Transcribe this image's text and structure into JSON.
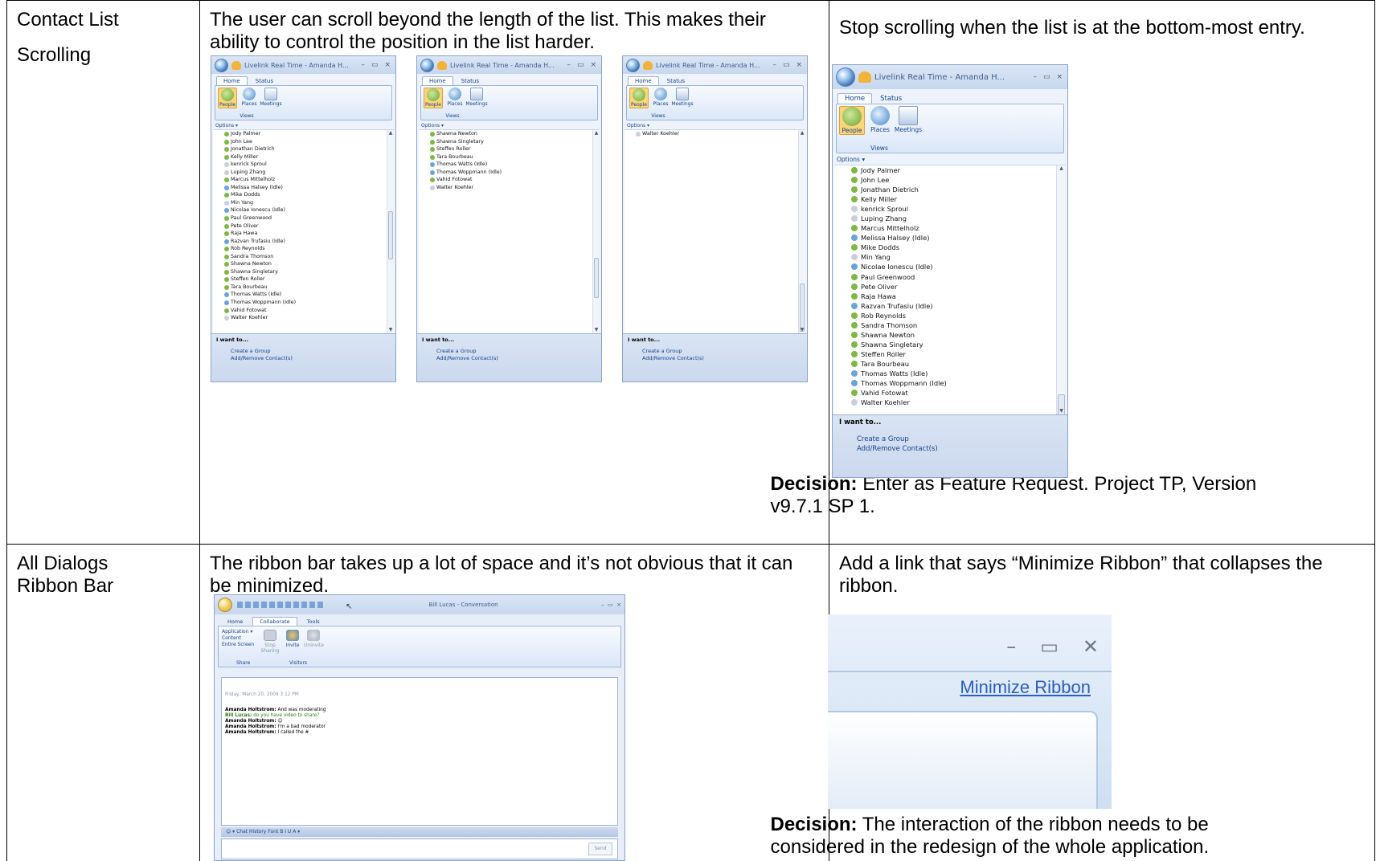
{
  "rows": [
    {
      "topic_lines": [
        "Contact List",
        "Scrolling"
      ],
      "issue": "The user can scroll beyond the length of the list. This makes their ability to control the position in the list harder.",
      "recommendation": "Stop scrolling when the list is at the bottom-most entry.",
      "decision_label": "Decision:",
      "decision": "Enter as Feature Request. Project TP, Version v9.7.1 SP 1."
    },
    {
      "topic_lines": [
        "All Dialogs",
        "Ribbon Bar"
      ],
      "issue": "The ribbon bar takes up a lot of space and it’s not obvious that it can be minimized.",
      "recommendation": "Add a link that says “Minimize Ribbon” that collapses the ribbon.",
      "decision_label": "Decision:",
      "decision": "The interaction of the ribbon needs to be considered in the redesign of the whole application."
    }
  ],
  "livelink": {
    "title": "Livelink Real Time - Amanda H...",
    "tabs": [
      "Home",
      "Status"
    ],
    "ribbon_buttons": [
      "People",
      "Places",
      "Meetings"
    ],
    "views_label": "Views",
    "options_label": "Options ▾",
    "window_controls": [
      "–",
      "▭",
      "×"
    ],
    "i_want_to": "I want to...",
    "actions": [
      "Create a Group",
      "Add/Remove Contact(s)"
    ],
    "contacts_full": [
      "Jody Palmer",
      "John Lee",
      "Jonathan Dietrich",
      "Kelly Miller",
      "kenrick Sproul",
      "Luping Zhang",
      "Marcus Mittelholz",
      "Melissa Halsey (Idle)",
      "Mike Dodds",
      "Min Yang",
      "Nicolae Ionescu (Idle)",
      "Paul Greenwood",
      "Pete Oliver",
      "Raja Hawa",
      "Razvan Trufasiu (Idle)",
      "Rob Reynolds",
      "Sandra Thomson",
      "Shawna Newton",
      "Shawna Singletary",
      "Steffen Roller",
      "Tara Bourbeau",
      "Thomas Watts (Idle)",
      "Thomas Woppmann (Idle)",
      "Vahid Fotowat",
      "Walter Koehler"
    ],
    "contacts_partial": [
      "Shawna Newton",
      "Shawna Singletary",
      "Steffen Roller",
      "Tara Bourbeau",
      "Thomas Watts (Idle)",
      "Thomas Woppmann (Idle)",
      "Vahid Fotowat",
      "Walter Koehler"
    ],
    "contacts_last": [
      "Walter Koehler"
    ]
  },
  "conversation": {
    "title": "Bill Lucas - Conversation",
    "tabs": [
      "Home",
      "Collaborate",
      "Tools"
    ],
    "share_items": [
      "Application ▾",
      "Content",
      "Entire Screen"
    ],
    "stop_sharing": "Stop Sharing",
    "invite": "Invite",
    "uninvite": "Uninvite",
    "group_share": "Share",
    "group_visitors": "Visitors",
    "date_line": "Friday, March 20, 2009 3:12 PM",
    "messages": [
      {
        "sender": "Amanda Holtstrom:",
        "text": "And was moderating",
        "green": false
      },
      {
        "sender": "Bill Lucas:",
        "text": "do you have video to share?",
        "green": true
      },
      {
        "sender": "Amanda Holtstrom:",
        "text": "☺",
        "green": false
      },
      {
        "sender": "Amanda Holtstrom:",
        "text": "I'm a bad moderator",
        "green": false
      },
      {
        "sender": "Amanda Holtstrom:",
        "text": "I called the #",
        "green": false
      }
    ],
    "format_bar": "☺ ▾  Chat History  Font  B  I  U  A ▾",
    "send_label": "Send"
  },
  "zoom": {
    "minimize_link": "Minimize Ribbon",
    "controls": [
      "–",
      "▭",
      "✕"
    ]
  }
}
